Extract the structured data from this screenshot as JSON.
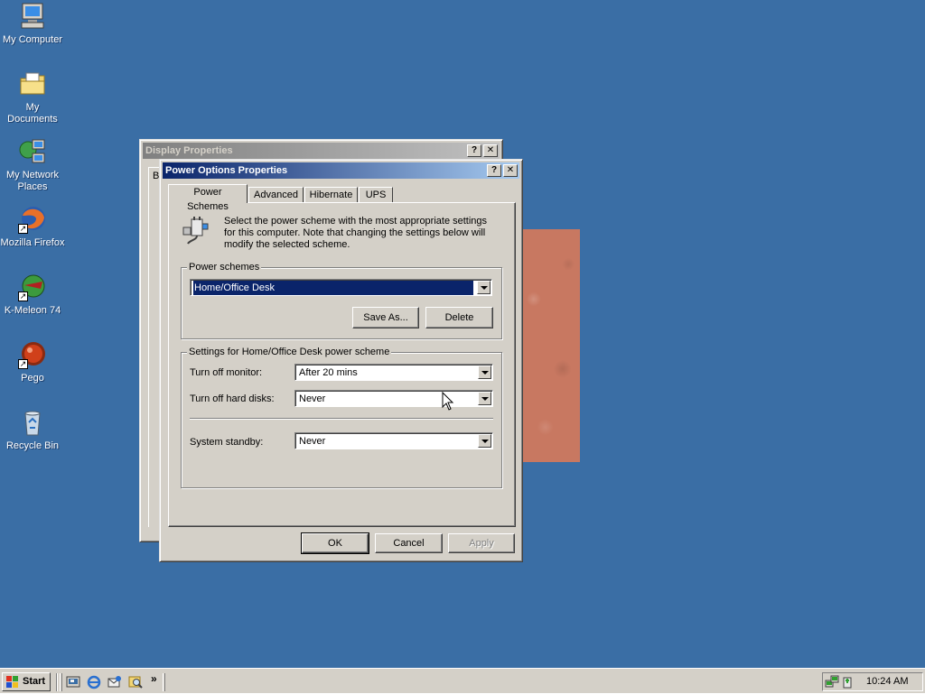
{
  "desktop": {
    "icons": [
      {
        "label": "My Computer",
        "icon": "my-computer-icon"
      },
      {
        "label": "My Documents",
        "icon": "my-documents-icon"
      },
      {
        "label": "My Network Places",
        "icon": "network-places-icon"
      },
      {
        "label": "Mozilla Firefox",
        "icon": "firefox-icon"
      },
      {
        "label": "K-Meleon 74",
        "icon": "kmeleon-icon"
      },
      {
        "label": "Pego",
        "icon": "pego-icon"
      },
      {
        "label": "Recycle Bin",
        "icon": "recycle-bin-icon"
      }
    ]
  },
  "display_window": {
    "title": "Display Properties",
    "tab_peek": "B"
  },
  "power_window": {
    "title": "Power Options Properties",
    "help_btn": "?",
    "close_btn": "✕",
    "tabs": [
      "Power Schemes",
      "Advanced",
      "Hibernate",
      "UPS"
    ],
    "description": "Select the power scheme with the most appropriate settings for this computer. Note that changing the settings below will modify the selected scheme.",
    "schemes_group": "Power schemes",
    "scheme_value": "Home/Office Desk",
    "save_as": "Save As...",
    "delete": "Delete",
    "settings_group": "Settings for Home/Office Desk power scheme",
    "monitor_label": "Turn off monitor:",
    "monitor_value": "After 20 mins",
    "disks_label": "Turn off hard disks:",
    "disks_value": "Never",
    "standby_label": "System standby:",
    "standby_value": "Never",
    "ok": "OK",
    "cancel": "Cancel",
    "apply": "Apply"
  },
  "taskbar": {
    "start": "Start",
    "chevron": "»",
    "clock": "10:24 AM"
  }
}
